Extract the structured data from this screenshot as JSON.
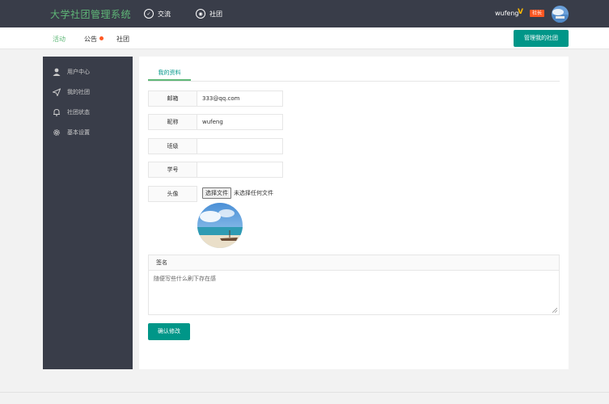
{
  "topbar": {
    "brand": "大学社团管理系统",
    "nav": [
      {
        "label": "交流",
        "icon": "chat-icon"
      },
      {
        "label": "社团",
        "icon": "camera-icon"
      }
    ],
    "user": {
      "name": "wufeng",
      "vip": "V",
      "role": "社长"
    }
  },
  "subnav": {
    "links": [
      "活动",
      "公告",
      "社团"
    ],
    "manage_button": "管理我的社团"
  },
  "sidebar": {
    "items": [
      {
        "label": "用户中心",
        "icon": "user-icon"
      },
      {
        "label": "我的社团",
        "icon": "send-icon"
      },
      {
        "label": "社团状态",
        "icon": "bell-icon"
      },
      {
        "label": "基本设置",
        "icon": "gear-icon"
      }
    ]
  },
  "profile": {
    "tab": "我的资料",
    "fields": [
      {
        "label": "邮箱",
        "value": "333@qq.com"
      },
      {
        "label": "昵称",
        "value": "wufeng"
      },
      {
        "label": "班级",
        "value": ""
      },
      {
        "label": "学号",
        "value": ""
      }
    ],
    "avatar_label": "头像",
    "file_button": "选择文件",
    "file_status": "未选择任何文件",
    "signature_label": "签名",
    "signature_text": "随便写些什么刷下存在感",
    "confirm_button": "确认修改"
  },
  "colors": {
    "accent": "#009688",
    "topbar": "#393d49",
    "brand": "#5fb878",
    "badge": "#ff5722"
  }
}
